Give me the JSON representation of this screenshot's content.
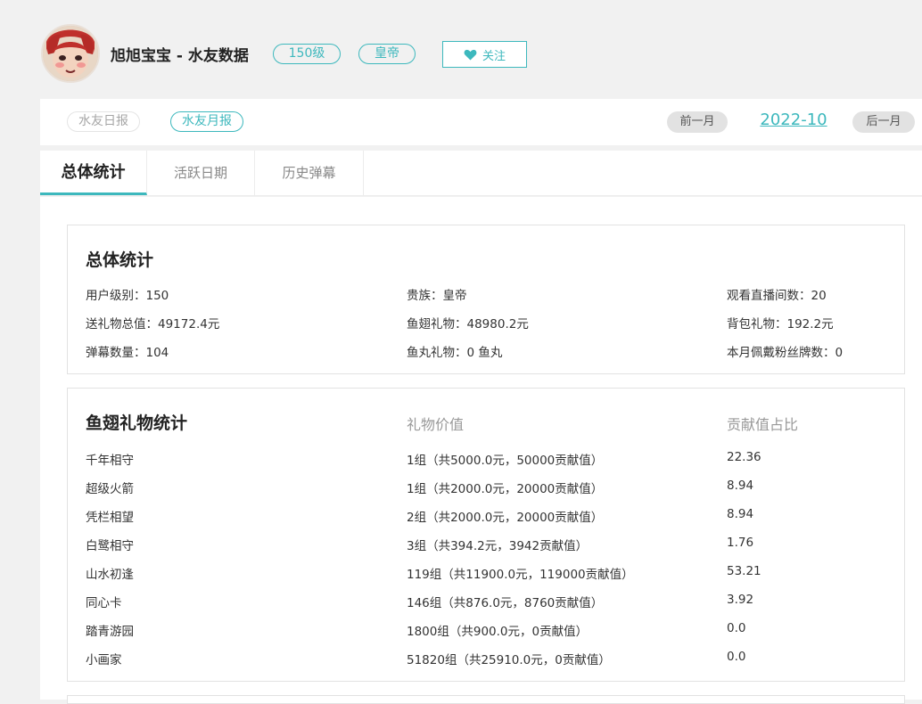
{
  "header": {
    "username": "旭旭宝宝 - 水友数据",
    "level_badge": "150级",
    "noble_badge": "皇帝",
    "follow_label": "关注"
  },
  "report": {
    "daily_label": "水友日报",
    "monthly_label": "水友月报",
    "prev_month_label": "前一月",
    "current_month": "2022-10",
    "next_month_label": "后一月"
  },
  "tabs": [
    {
      "label": "总体统计"
    },
    {
      "label": "活跃日期"
    },
    {
      "label": "历史弹幕"
    }
  ],
  "overall": {
    "title": "总体统计",
    "stats": [
      "用户级别：150",
      "贵族：皇帝",
      "观看直播间数：20",
      "送礼物总值：49172.4元",
      "鱼翅礼物：48980.2元",
      "背包礼物：192.2元",
      "弹幕数量：104",
      "鱼丸礼物：0 鱼丸",
      "本月佩戴粉丝牌数：0"
    ]
  },
  "gifts": {
    "title": "鱼翅礼物统计",
    "col_value": "礼物价值",
    "col_ratio": "贡献值占比",
    "rows": [
      {
        "name": "千年相守",
        "value": "1组（共5000.0元，50000贡献值）",
        "ratio": "22.36"
      },
      {
        "name": "超级火箭",
        "value": "1组（共2000.0元，20000贡献值）",
        "ratio": "8.94"
      },
      {
        "name": "凭栏相望",
        "value": "2组（共2000.0元，20000贡献值）",
        "ratio": "8.94"
      },
      {
        "name": "白鹭相守",
        "value": "3组（共394.2元，3942贡献值）",
        "ratio": "1.76"
      },
      {
        "name": "山水初逢",
        "value": "119组（共11900.0元，119000贡献值）",
        "ratio": "53.21"
      },
      {
        "name": "同心卡",
        "value": "146组（共876.0元，8760贡献值）",
        "ratio": "3.92"
      },
      {
        "name": "踏青游园",
        "value": "1800组（共900.0元，0贡献值）",
        "ratio": "0.0"
      },
      {
        "name": "小画家",
        "value": "51820组（共25910.0元，0贡献值）",
        "ratio": "0.0"
      }
    ]
  },
  "colors": {
    "accent": "#3db8bd",
    "page_bg": "#f1f1f1"
  }
}
